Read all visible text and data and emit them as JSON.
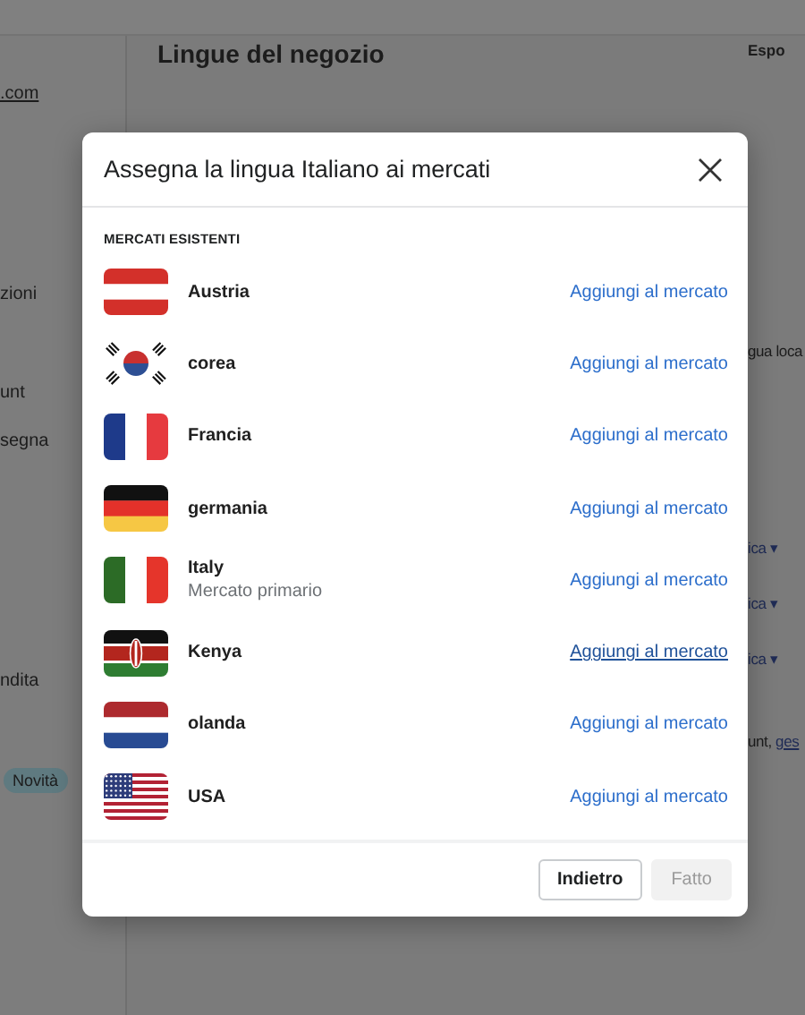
{
  "background": {
    "sidebar": [
      {
        "text": ".com",
        "kind": "link"
      },
      {
        "text": "zioni",
        "kind": "text"
      },
      {
        "text": "unt",
        "kind": "text"
      },
      {
        "text": "segna",
        "kind": "text"
      },
      {
        "text": "ndita",
        "kind": "text"
      },
      {
        "text": "Novità",
        "kind": "badge"
      }
    ],
    "title": "Lingue del negozio",
    "header_action": "Espo",
    "fragments": [
      {
        "text": "gua loca",
        "kind": "text"
      },
      {
        "text": "ica ▾",
        "kind": "dropdown"
      },
      {
        "text": "ica ▾",
        "kind": "dropdown"
      },
      {
        "text": "ica ▾",
        "kind": "dropdown"
      },
      {
        "text": "unt,",
        "kind": "text",
        "link": "ges"
      }
    ]
  },
  "dialog": {
    "title": "Assegna la lingua Italiano ai mercati",
    "section_label": "MERCATI ESISTENTI",
    "markets": [
      {
        "name": "Austria",
        "kind": "austria",
        "action": "Aggiungi al mercato",
        "hovered": false
      },
      {
        "name": "corea",
        "kind": "korea",
        "action": "Aggiungi al mercato",
        "hovered": false
      },
      {
        "name": "Francia",
        "kind": "france",
        "action": "Aggiungi al mercato",
        "hovered": false
      },
      {
        "name": "germania",
        "kind": "germany",
        "action": "Aggiungi al mercato",
        "hovered": false
      },
      {
        "name": "Italy",
        "subtitle": "Mercato primario",
        "kind": "italy",
        "action": "Aggiungi al mercato",
        "hovered": false
      },
      {
        "name": "Kenya",
        "kind": "kenya",
        "action": "Aggiungi al mercato",
        "hovered": true
      },
      {
        "name": "olanda",
        "kind": "netherlands",
        "action": "Aggiungi al mercato",
        "hovered": false
      },
      {
        "name": "USA",
        "kind": "usa",
        "action": "Aggiungi al mercato",
        "hovered": false
      }
    ],
    "buttons": [
      {
        "label": "Indietro",
        "kind": "secondary",
        "disabled": false
      },
      {
        "label": "Fatto",
        "kind": "primary",
        "disabled": true
      }
    ]
  }
}
